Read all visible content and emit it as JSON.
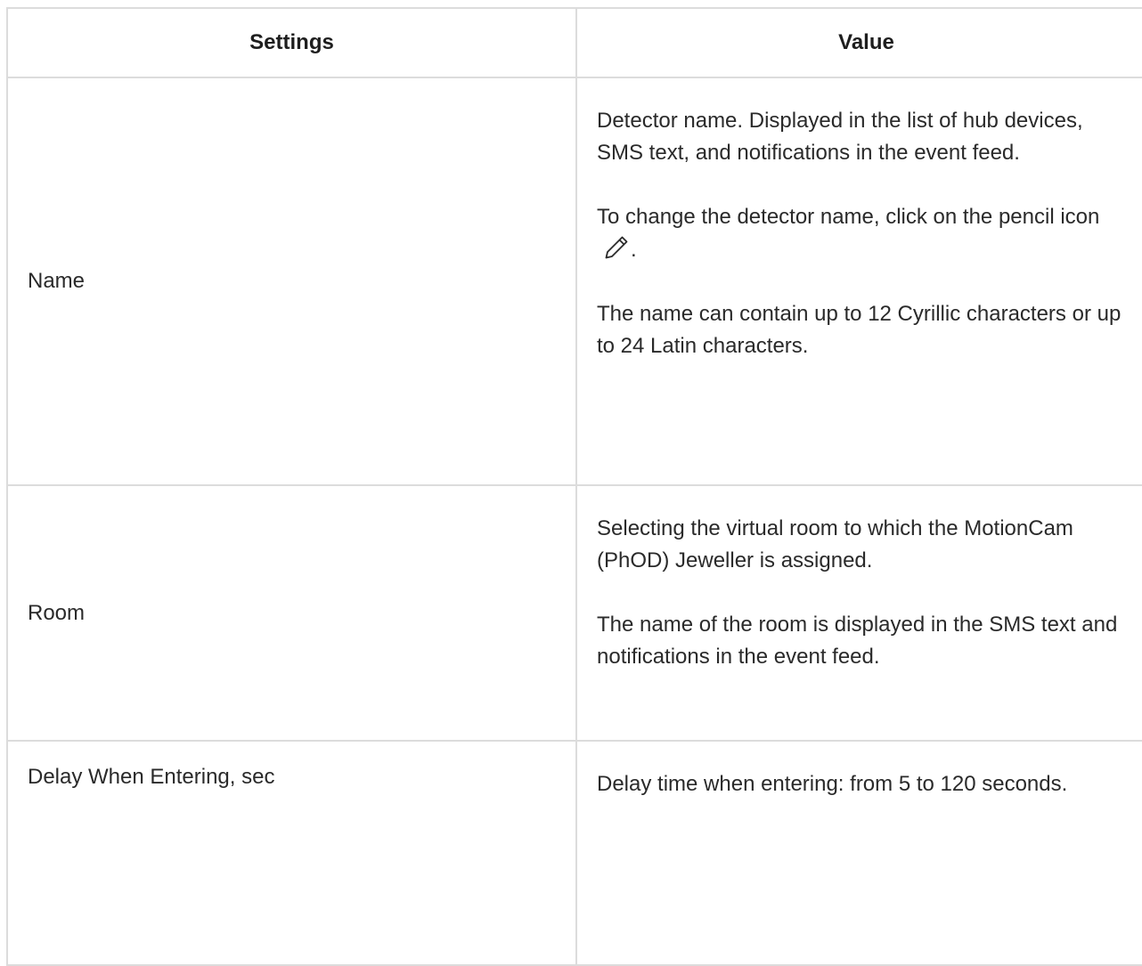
{
  "table": {
    "headers": {
      "settings": "Settings",
      "value": "Value"
    },
    "rows": [
      {
        "setting": "Name",
        "paragraphs": [
          "Detector name. Displayed in the list of hub devices, SMS text, and notifications in the event feed.",
          "To change the detector name, click on the pencil icon",
          "The name can contain up to 12 Cyrillic characters or up to 24 Latin characters."
        ],
        "pencil_suffix": ".",
        "icon": "pencil-icon"
      },
      {
        "setting": "Room",
        "paragraphs": [
          "Selecting the virtual room to which the MotionCam (PhOD) Jeweller is assigned.",
          "The name of the room is displayed in the SMS text and notifications in the event feed."
        ]
      },
      {
        "setting": "Delay When Entering, sec",
        "paragraphs": [
          "Delay time when entering: from 5 to 120 seconds."
        ]
      }
    ]
  },
  "colors": {
    "border": "#dcdcdc",
    "text": "#2a2a2a",
    "header_text": "#1e1e1e"
  }
}
